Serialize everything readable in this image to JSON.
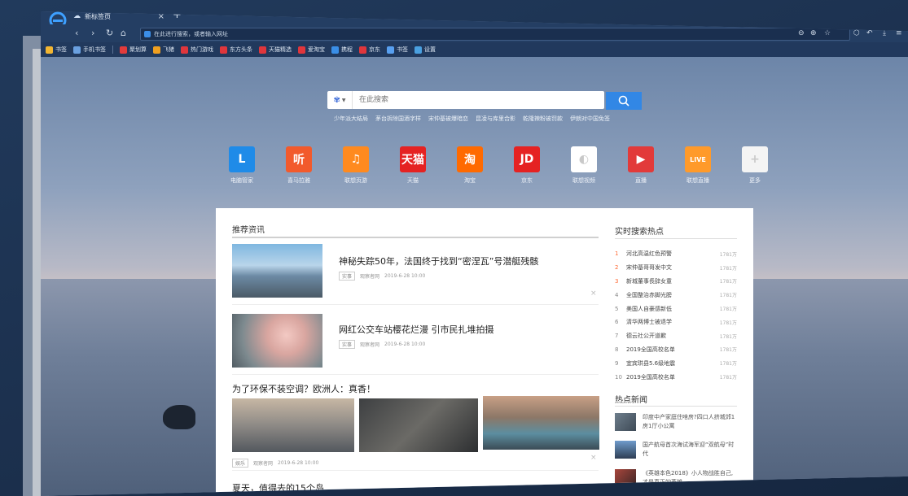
{
  "browser": {
    "tab_title": "新标签页",
    "address_placeholder": "在此进行搜索，或者输入网址"
  },
  "bookmarks": [
    {
      "label": "书签",
      "icon": "star-icon",
      "color": "#f2b632"
    },
    {
      "label": "手机书签",
      "icon": "phone-icon",
      "color": "#6aa0e0"
    },
    {
      "label": "聚划算",
      "icon": "juhuasuan-icon",
      "color": "#e23b3b"
    },
    {
      "label": "飞猪",
      "icon": "fliggy-icon",
      "color": "#f0a020"
    },
    {
      "label": "热门游戏",
      "icon": "game-icon",
      "color": "#e0363c"
    },
    {
      "label": "东方头条",
      "icon": "news-icon",
      "color": "#e0363c"
    },
    {
      "label": "天猫精选",
      "icon": "tmall-icon",
      "color": "#e0363c"
    },
    {
      "label": "爱淘宝",
      "icon": "taobao-icon",
      "color": "#e0363c"
    },
    {
      "label": "携程",
      "icon": "ctrip-icon",
      "color": "#3a8ee6"
    },
    {
      "label": "京东",
      "icon": "jd-icon",
      "color": "#e0363c"
    },
    {
      "label": "书签",
      "icon": "star-icon",
      "color": "#58a0f0"
    },
    {
      "label": "设置",
      "icon": "settings-icon",
      "color": "#4aa0e0"
    }
  ],
  "search": {
    "placeholder": "在此搜索",
    "hotwords": [
      "少年派大结局",
      "茅台拆除国酒字样",
      "宋仲基被爆暗恋",
      "昆凌与库里合影",
      "乾隆辣粉被罚款",
      "伊朗对中国免签"
    ]
  },
  "apps": [
    {
      "label": "电脑管家",
      "glyph": "L",
      "color": "#1f8be8"
    },
    {
      "label": "喜马拉雅",
      "glyph": "听",
      "color": "#f25a2c"
    },
    {
      "label": "联想页游",
      "glyph": "♫",
      "color": "#ff8a1f"
    },
    {
      "label": "天猫",
      "glyph": "天猫",
      "color": "#e52222"
    },
    {
      "label": "淘宝",
      "glyph": "淘",
      "color": "#ff6a00"
    },
    {
      "label": "京东",
      "glyph": "JD",
      "color": "#e52222"
    },
    {
      "label": "联想视频",
      "glyph": "◐",
      "color": "#ffffff"
    },
    {
      "label": "直播",
      "glyph": "▶",
      "color": "#e23a3a"
    },
    {
      "label": "联想直播",
      "glyph": "LIVE",
      "color": "#ff9a2a"
    },
    {
      "label": "更多",
      "glyph": "+",
      "color": "#f4f4f4"
    }
  ],
  "feed": {
    "title": "推荐资讯",
    "items": [
      {
        "title": "神秘失踪50年，法国终于找到“密涅瓦”号潜艇残骸",
        "tag": "实事",
        "source": "观察者网",
        "time": "2019-6-28 10:00"
      },
      {
        "title": "网红公交车站樱花烂漫 引市民扎堆拍摄",
        "tag": "实事",
        "source": "观察者网",
        "time": "2019-6-28 10:00"
      },
      {
        "title": "为了环保不装空调？欧洲人：真香！",
        "tag": "娱乐",
        "source": "观察者网",
        "time": "2019-6-28 10:00"
      },
      {
        "title": "夏天，值得去的15个岛"
      }
    ]
  },
  "hot_search": {
    "title": "实时搜索热点",
    "items": [
      {
        "rank": "1",
        "text": "河北高温红色预警",
        "count": "1781万"
      },
      {
        "rank": "2",
        "text": "宋仲基哥哥发中文",
        "count": "1781万"
      },
      {
        "rank": "3",
        "text": "新城董事長辞女童",
        "count": "1781万"
      },
      {
        "rank": "4",
        "text": "全国整治赤脚光膀",
        "count": "1781万"
      },
      {
        "rank": "5",
        "text": "美国人自豪感新低",
        "count": "1781万"
      },
      {
        "rank": "6",
        "text": "清华两博士被退学",
        "count": "1781万"
      },
      {
        "rank": "7",
        "text": "德云社公开道歉",
        "count": "1781万"
      },
      {
        "rank": "8",
        "text": "2019全国高校名单",
        "count": "1781万"
      },
      {
        "rank": "9",
        "text": "宜宾珙县5.6级地震",
        "count": "1781万"
      },
      {
        "rank": "10",
        "text": "2019全国高校名单",
        "count": "1781万"
      }
    ]
  },
  "hot_news": {
    "title": "热点新闻",
    "items": [
      {
        "text": "印度中产家庭住啥房?四口人挤城郊1房1厅小公寓"
      },
      {
        "text": "国产航母首次海试海军迎“双航母”时代"
      },
      {
        "text": "《英雄本色2018》小人物战胜自己,才是真正的英雄"
      }
    ]
  }
}
